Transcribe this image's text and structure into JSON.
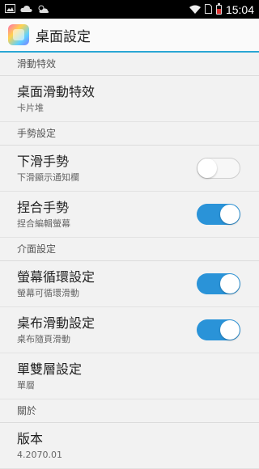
{
  "status_bar": {
    "left_icons": [
      "image-icon",
      "cloud-icon",
      "weather-icon"
    ],
    "right_icons": [
      "wifi-icon",
      "sim-icon",
      "battery-icon"
    ],
    "time": "15:04"
  },
  "app_bar": {
    "title": "桌面設定",
    "accent_color": "#2aa6d4"
  },
  "sections": [
    {
      "label": "滑動特效",
      "items": [
        {
          "title": "桌面滑動特效",
          "subtitle": "卡片堆"
        }
      ]
    },
    {
      "label": "手勢設定",
      "items": [
        {
          "title": "下滑手勢",
          "subtitle": "下滑顯示通知欄",
          "toggle": "off"
        },
        {
          "title": "捏合手勢",
          "subtitle": "捏合編輯螢幕",
          "toggle": "on"
        }
      ]
    },
    {
      "label": "介面設定",
      "items": [
        {
          "title": "螢幕循環設定",
          "subtitle": "螢幕可循環滑動",
          "toggle": "on"
        },
        {
          "title": "桌布滑動設定",
          "subtitle": "桌布隨頁滑動",
          "toggle": "on"
        },
        {
          "title": "單雙層設定",
          "subtitle": "單層"
        }
      ]
    },
    {
      "label": "關於",
      "items": [
        {
          "title": "版本",
          "subtitle": "4.2070.01"
        }
      ]
    }
  ]
}
